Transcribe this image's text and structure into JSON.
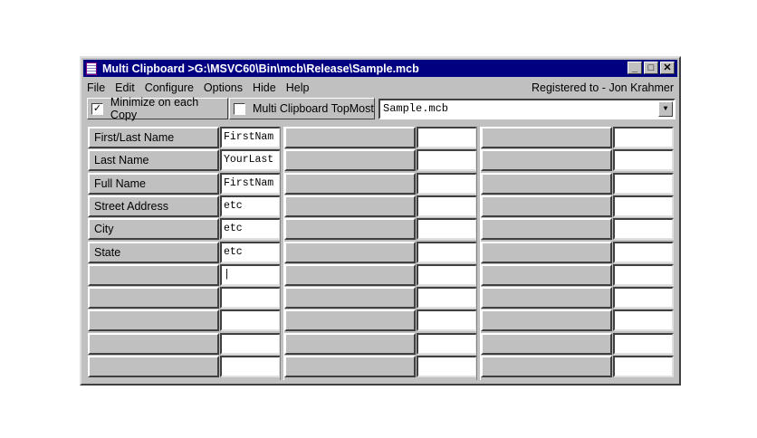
{
  "window": {
    "title": "Multi Clipboard >G:\\MSVC60\\Bin\\mcb\\Release\\Sample.mcb"
  },
  "menu": {
    "items": [
      "File",
      "Edit",
      "Configure",
      "Options",
      "Hide",
      "Help"
    ],
    "registered": "Registered to - Jon Krahmer"
  },
  "toolbar": {
    "minimize_label": "Minimize on each Copy",
    "minimize_checked": true,
    "topmost_label": "Multi Clipboard TopMost",
    "topmost_checked": false,
    "file_value": "Sample.mcb"
  },
  "grid": {
    "groups": [
      {
        "labels": [
          "First/Last Name",
          "Last Name",
          "Full Name",
          "Street Address",
          "City",
          "State",
          "",
          "",
          "",
          "",
          ""
        ],
        "values": [
          "FirstNam",
          "YourLast",
          "FirstNam",
          "etc",
          "etc",
          "etc",
          "|",
          "",
          "",
          "",
          ""
        ]
      },
      {
        "labels": [
          "",
          "",
          "",
          "",
          "",
          "",
          "",
          "",
          "",
          "",
          ""
        ],
        "values": [
          "",
          "",
          "",
          "",
          "",
          "",
          "",
          "",
          "",
          "",
          ""
        ]
      },
      {
        "labels": [
          "",
          "",
          "",
          "",
          "",
          "",
          "",
          "",
          "",
          "",
          ""
        ],
        "values": [
          "",
          "",
          "",
          "",
          "",
          "",
          "",
          "",
          "",
          "",
          ""
        ]
      }
    ]
  }
}
